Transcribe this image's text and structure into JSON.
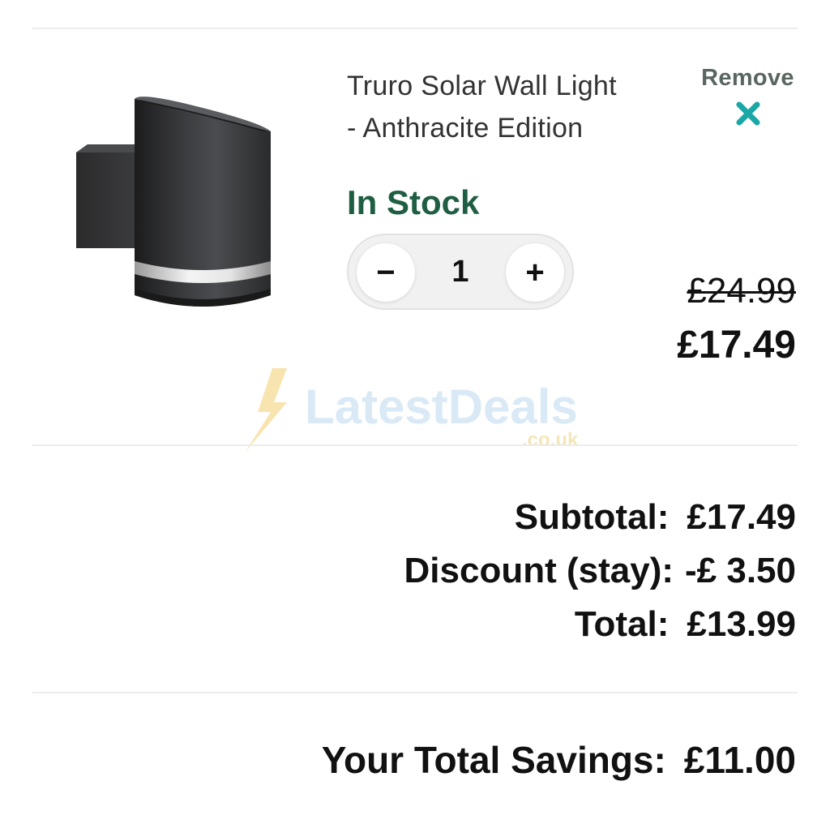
{
  "product": {
    "title_line1": "Truro Solar Wall Light",
    "title_line2": "- Anthracite Edition",
    "stock_status": "In Stock",
    "quantity": "1",
    "minus_label": "−",
    "plus_label": "+",
    "old_price": "£24.99",
    "new_price": "£17.49",
    "image_icon": "solar-wall-light-image"
  },
  "remove": {
    "label": "Remove",
    "icon": "close-x-icon",
    "color": "#1aa7a5"
  },
  "watermark": {
    "brand": "LatestDeals",
    "domain": ".co.uk"
  },
  "summary": {
    "subtotal_label": "Subtotal:",
    "subtotal_value": "£17.49",
    "discount_label": "Discount (stay):",
    "discount_value": "-£ 3.50",
    "total_label": "Total:",
    "total_value": "£13.99"
  },
  "savings": {
    "label": "Your Total Savings:",
    "value": "£11.00"
  },
  "colors": {
    "stock_green": "#1f5e43",
    "remove_teal": "#1aa7a5",
    "text": "#111111"
  }
}
